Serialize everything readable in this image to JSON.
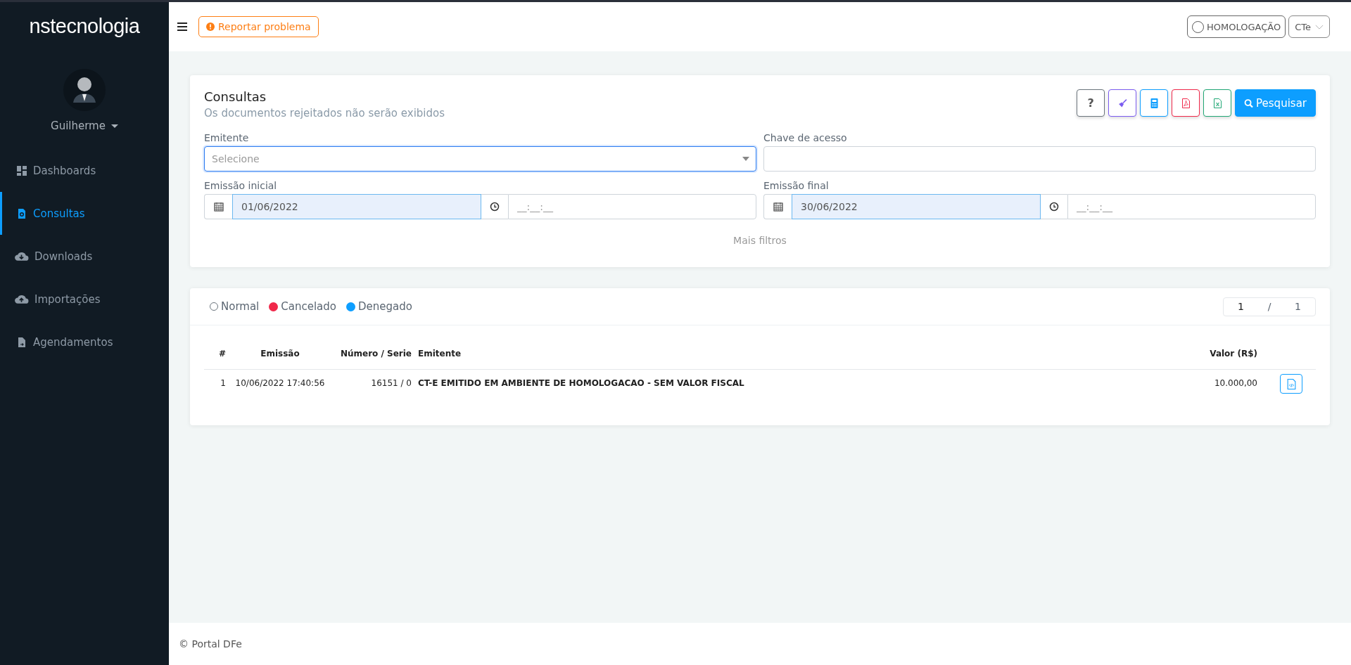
{
  "sidebar": {
    "logo": "**ns**tecnologia",
    "user": {
      "name": "Guilherme"
    },
    "items": [
      {
        "kind": "dashboard",
        "label": "Dashboards",
        "selected": false
      },
      {
        "kind": "search-doc",
        "label": "Consultas",
        "selected": true
      },
      {
        "kind": "download",
        "label": "Downloads",
        "selected": false
      },
      {
        "kind": "upload",
        "label": "Importações",
        "selected": false
      },
      {
        "kind": "file",
        "label": "Agendamentos",
        "selected": false
      }
    ]
  },
  "header": {
    "report_button": "Reportar problema",
    "environment": {
      "label": "HOMOLOGAÇÃO",
      "on": false
    },
    "document_type": "CTe"
  },
  "filters": {
    "title": "Consultas",
    "subtitle": "Os documentos rejeitados não serão exibidos",
    "buttons": [
      {
        "kind": "help",
        "label": "?"
      },
      {
        "kind": "clean"
      },
      {
        "kind": "calculator"
      },
      {
        "kind": "pdf"
      },
      {
        "kind": "excel"
      },
      {
        "kind": "search",
        "label": "Pesquisar"
      }
    ],
    "emitente": {
      "label": "Emitente",
      "placeholder": "Selecione",
      "focused": true
    },
    "chave": {
      "label": "Chave de acesso"
    },
    "emissao_inicial": {
      "label": "Emissão inicial",
      "date": "01/06/2022",
      "time_placeholder": "__:__:__"
    },
    "emissao_final": {
      "label": "Emissão final",
      "date": "30/06/2022",
      "time_placeholder": "__:__:__"
    },
    "more": "Mais filtros"
  },
  "results": {
    "legend": [
      {
        "kind": "ring",
        "label": "Normal",
        "color": "#6c757d"
      },
      {
        "kind": "dot",
        "label": "Cancelado",
        "color": "#f0284a"
      },
      {
        "kind": "dot",
        "label": "Denegado",
        "color": "#0d9eff"
      }
    ],
    "page": {
      "current": "1",
      "separator": "/",
      "total": "1"
    },
    "table": {
      "columns": [
        "#",
        "Emissão",
        "Número / Serie",
        "Emitente",
        "Valor (R$)"
      ],
      "rows": [
        {
          "cells": [
            "1",
            "10/06/2022 17:40:56",
            "16151 / 0",
            "CT-E EMITIDO EM AMBIENTE DE HOMOLOGACAO - SEM VALOR FISCAL",
            "10.000,00"
          ]
        }
      ]
    }
  },
  "footer": "© Portal DFe"
}
